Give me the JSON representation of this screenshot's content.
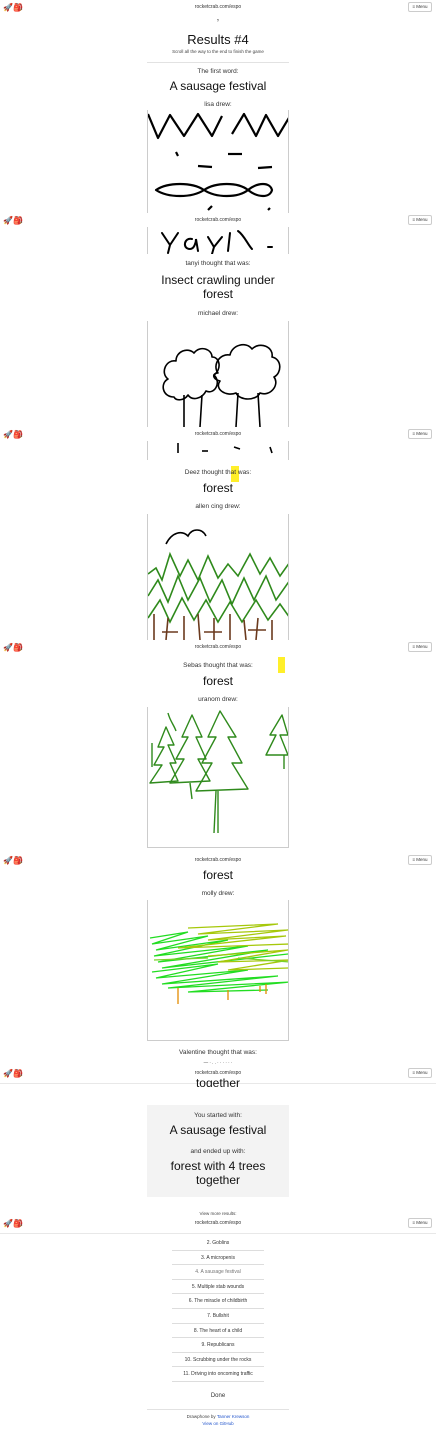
{
  "topbar": {
    "logo": "🚀🎒",
    "url": "rocketcrab.com/espo",
    "menu_label": "≡ Menu"
  },
  "results": {
    "title": "Results #4",
    "subtitle": "Scroll all the way to the end to finish the game",
    "first_word_label": "The first word:",
    "first_word": "A sausage festival",
    "chain": [
      {
        "drawer": "lisa drew:"
      },
      {
        "guess_label": "tanyi thought that was:",
        "guess": "Insect crawling under forest",
        "drawer": "michael drew:"
      },
      {
        "guess_label": "Deez thought that was:",
        "guess": "forest",
        "drawer": "allen cing drew:"
      },
      {
        "guess_label": "Sebas thought that was:",
        "guess": "forest",
        "drawer": "uranom drew:"
      },
      {
        "guess": "forest",
        "drawer": "molly drew:"
      },
      {
        "guess_label": "Valentine thought that was:"
      }
    ],
    "partial_bottom_word": "together",
    "summary": {
      "started_label": "You started with:",
      "started": "A sausage festival",
      "ended_label": "and ended up with:",
      "ended": "forest with 4 trees together"
    },
    "view_more": "View more results:",
    "list": [
      "2. Goblins",
      "3. A micropenis",
      "4. A sausage festival",
      "5. Multiple stab wounds",
      "6. The miracle of childbirth",
      "7. Bullshit",
      "8. The heart of a child",
      "9. Republicans",
      "10. Scrubbing under the rocks",
      "11. Driving into oncoming traffic"
    ],
    "done_label": "Done",
    "footer": {
      "by_prefix": "Drawphone by ",
      "by_name": "Tanner Krewson",
      "source": "View on GitHub"
    }
  }
}
